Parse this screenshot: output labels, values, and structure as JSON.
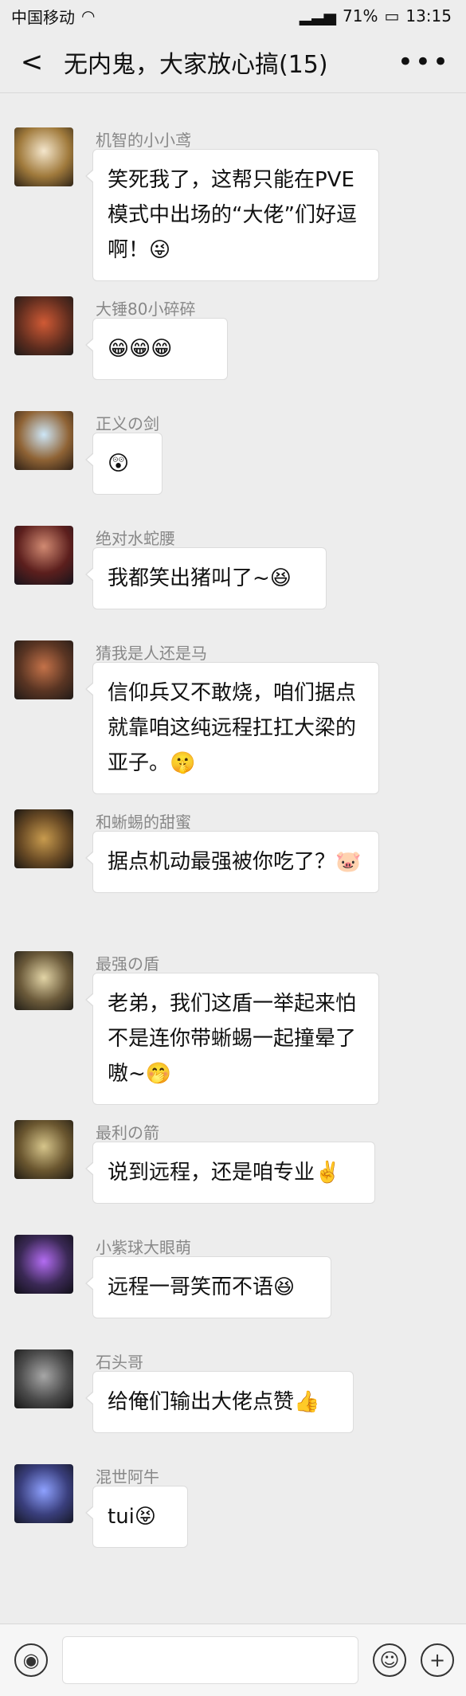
{
  "status": {
    "carrier": "中国移动",
    "signal": "71%",
    "time": "13:15"
  },
  "nav": {
    "title": "无内鬼，大家放心搞(15)",
    "back": "<",
    "more": "•••"
  },
  "messages": [
    {
      "name": "机智的小小鸢",
      "text": "笑死我了，这帮只能在PVE模式中出场的“大佬”们好逗啊！",
      "emoji": "😜"
    },
    {
      "name": "大锤80小碎碎",
      "text": "",
      "emoji": "😁😁😁"
    },
    {
      "name": "正义の剑",
      "text": "",
      "emoji": "😲"
    },
    {
      "name": "绝对水蛇腰",
      "text": "我都笑出猪叫了~",
      "emoji": "😆"
    },
    {
      "name": "猜我是人还是马",
      "text": "信仰兵又不敢烧，咱们据点就靠咱这纯远程扛扛大梁的亚子。",
      "emoji": "🤫"
    },
    {
      "name": "和蜥蜴的甜蜜",
      "text": "据点机动最强被你吃了？",
      "emoji": "🐷"
    },
    {
      "name": "最强の盾",
      "text": "老弟，我们这盾一举起来怕不是连你带蜥蜴一起撞晕了嗷~",
      "emoji": "🤭"
    },
    {
      "name": "最利の箭",
      "text": "说到远程，还是咱专业",
      "emoji": "✌️"
    },
    {
      "name": "小紫球大眼萌",
      "text": "远程一哥笑而不语",
      "emoji": "😆"
    },
    {
      "name": "石头哥",
      "text": "给俺们输出大佬点赞",
      "emoji": "👍"
    },
    {
      "name": "混世阿牛",
      "text": "tui",
      "emoji": "😝"
    }
  ]
}
